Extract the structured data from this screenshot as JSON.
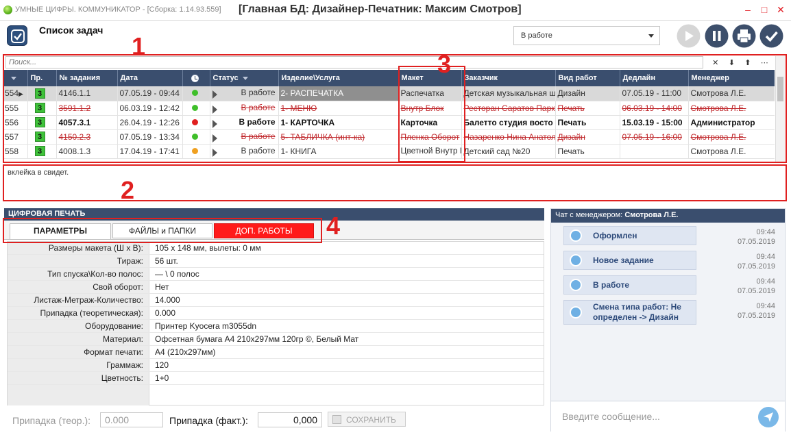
{
  "window": {
    "app_name": "УМНЫЕ ЦИФРЫ. КОММУНИКАТОР - [Сборка: 1.14.93.559]",
    "title": "[Главная БД: Дизайнер-Печатник: Максим Смотров]",
    "minimize": "–",
    "maximize": "□",
    "close": "✕"
  },
  "toolbar": {
    "title": "Список задач",
    "status_filter": "В работе"
  },
  "annotations": {
    "n1": "1",
    "n2": "2",
    "n3": "3",
    "n4": "4"
  },
  "search": {
    "placeholder": "Поиск...",
    "tools": [
      "✕",
      "⬇",
      "⬆",
      "⋯"
    ]
  },
  "grid": {
    "headers": {
      "pr": "Пр.",
      "number": "№ задания",
      "date": "Дата",
      "status": "Статус",
      "product": "Изделие\\Услуга",
      "maket": "Макет",
      "customer": "Заказчик",
      "work_type": "Вид работ",
      "deadline": "Дедлайн",
      "manager": "Менеджер"
    },
    "rows": [
      {
        "rownum": "554",
        "pr": "3",
        "number": "4146.1.1",
        "date": "07.05.19 - 09:44",
        "dot": "#3fbf2a",
        "status": "В работе",
        "product": "2- РАСПЕЧАТКА",
        "maket": "Распечатка",
        "customer": "Детская музыкальная ш",
        "work_type": "Дизайн",
        "deadline": "07.05.19 - 11:00",
        "manager": "Смотрова Л.Е.",
        "style": "sel"
      },
      {
        "rownum": "555",
        "pr": "3",
        "number": "3591.1.2",
        "date": "06.03.19 - 12:42",
        "dot": "#3fbf2a",
        "status": "В работе",
        "product": "1- МЕНЮ",
        "maket": "Внутр Блок",
        "customer": "Ресторан Саратов Парк",
        "work_type": "Печать",
        "deadline": "06.03.19 - 14:00",
        "manager": "Смотрова Л.Е.",
        "style": "strike"
      },
      {
        "rownum": "556",
        "pr": "3",
        "number": "4057.3.1",
        "date": "26.04.19 - 12:26",
        "dot": "#e02020",
        "status": "В работе",
        "product": "1- КАРТОЧКА",
        "maket": "Карточка",
        "customer": "Балетто студия восто",
        "work_type": "Печать",
        "deadline": "15.03.19 - 15:00",
        "manager": "Администратор",
        "style": "bold"
      },
      {
        "rownum": "557",
        "pr": "3",
        "number": "4150.2.3",
        "date": "07.05.19 - 13:34",
        "dot": "#3fbf2a",
        "status": "В работе",
        "product": "5- ТАБЛИЧКА (инт-ка)",
        "maket": "Пленка Оборот",
        "customer": "Назаренко Нина Анатол",
        "work_type": "Дизайн",
        "deadline": "07.05.19 - 16:00",
        "manager": "Смотрова Л.Е.",
        "style": "strike"
      },
      {
        "rownum": "558",
        "pr": "3",
        "number": "4008.1.3",
        "date": "17.04.19 - 17:41",
        "dot": "#f0a020",
        "status": "В работе",
        "product": "1- КНИГА",
        "maket": "Цветной Внутр Блок",
        "customer": "Детский сад №20",
        "work_type": "Печать",
        "deadline": "",
        "manager": "Смотрова Л.Е.",
        "style": "normal"
      }
    ]
  },
  "comment": "вклейка в свидет.",
  "left_panel": {
    "section_title": "ЦИФРОВАЯ ПЕЧАТЬ",
    "tabs": [
      "ПАРАМЕТРЫ",
      "ФАЙЛЫ и ПАПКИ",
      "ДОП. РАБОТЫ"
    ],
    "params": [
      {
        "label": "Размеры макета (Ш х В):",
        "value": "105 х 148 мм,  вылеты: 0 мм"
      },
      {
        "label": "Тираж:",
        "value": "56 шт."
      },
      {
        "label": "Тип спуска\\Кол-во полос:",
        "value": " — \\ 0 полос"
      },
      {
        "label": "Свой оборот:",
        "value": "Нет"
      },
      {
        "label": "Листаж-Метраж-Количество:",
        "value": "14.000"
      },
      {
        "label": "Припадка (теоретическая):",
        "value": "0.000"
      },
      {
        "label": "Оборудование:",
        "value": "Принтер Kyocera m3055dn"
      },
      {
        "label": "Материал:",
        "value": "Офсетная бумага А4 210х297мм 120гр ©, Белый Мат"
      },
      {
        "label": "Формат печати:",
        "value": "А4 (210х297мм)"
      },
      {
        "label": "Граммаж:",
        "value": "120"
      },
      {
        "label": "Цветность:",
        "value": "1+0"
      }
    ],
    "bottom": {
      "theor_label": "Припадка (теор.):",
      "theor_value": "0.000",
      "fact_label": "Припадка (факт.):",
      "fact_value": "0,000",
      "save_label": "СОХРАНИТЬ"
    }
  },
  "chat": {
    "header_prefix": "Чат с менеджером:",
    "manager": "Смотрова Л.Е.",
    "messages": [
      {
        "text": "Оформлен",
        "time": "09:44",
        "date": "07.05.2019"
      },
      {
        "text": "Новое задание",
        "time": "09:44",
        "date": "07.05.2019"
      },
      {
        "text": "В работе",
        "time": "09:44",
        "date": "07.05.2019"
      },
      {
        "text": "Смена типа работ: Не определен -> Дизайн",
        "time": "09:44",
        "date": "07.05.2019"
      }
    ],
    "input_placeholder": "Введите сообщение..."
  },
  "colors": {
    "header_bg": "#3a4e6e",
    "annotation_red": "#e02020",
    "priority_green": "#3fc23a",
    "tab_red": "#ff1a1a"
  }
}
